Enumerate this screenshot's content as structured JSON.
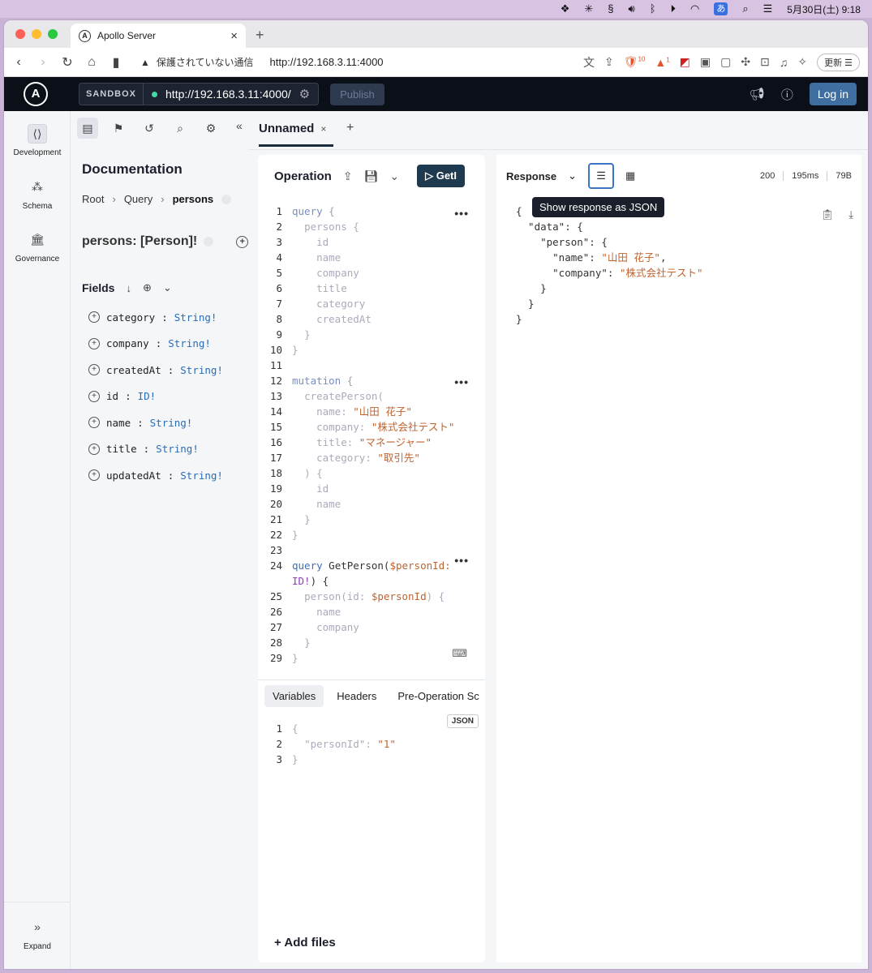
{
  "menubar": {
    "kana": "あ",
    "datetime": "5月30日(土)  9:18"
  },
  "browser": {
    "tab_title": "Apollo Server",
    "insecure_label": "保護されていない通信",
    "url": "http://192.168.3.11:4000",
    "brave_badge": "10",
    "alert_badge": "1",
    "update_label": "更新"
  },
  "header": {
    "sandbox_label": "SANDBOX",
    "endpoint": "http://192.168.3.11:4000/",
    "publish_label": "Publish",
    "login_label": "Log in"
  },
  "rail": {
    "items": [
      {
        "label": "Development"
      },
      {
        "label": "Schema"
      },
      {
        "label": "Governance"
      }
    ],
    "expand_label": "Expand"
  },
  "docs": {
    "title": "Documentation",
    "breadcrumb": [
      "Root",
      "Query",
      "persons"
    ],
    "type_title": "persons: [Person]!",
    "fields_label": "Fields",
    "fields": [
      {
        "name": "category",
        "type": "String!"
      },
      {
        "name": "company",
        "type": "String!"
      },
      {
        "name": "createdAt",
        "type": "String!"
      },
      {
        "name": "id",
        "type": "ID!"
      },
      {
        "name": "name",
        "type": "String!"
      },
      {
        "name": "title",
        "type": "String!"
      },
      {
        "name": "updatedAt",
        "type": "String!"
      }
    ]
  },
  "operation_tab": {
    "name": "Unnamed",
    "close": "×",
    "new": "+"
  },
  "operation": {
    "title": "Operation",
    "run_label": "▷ GetI",
    "line_numbers": [
      "1",
      "2",
      "3",
      "4",
      "5",
      "6",
      "7",
      "8",
      "9",
      "10",
      "11",
      "12",
      "13",
      "14",
      "15",
      "16",
      "17",
      "18",
      "19",
      "20",
      "21",
      "22",
      "23",
      "24",
      "",
      "25",
      "26",
      "27",
      "28",
      "29"
    ],
    "lines": {
      "l1_kw": "query",
      "l1_rest": " {",
      "l2": "persons {",
      "l3": "id",
      "l4": "name",
      "l5": "company",
      "l6": "title",
      "l7": "category",
      "l8": "createdAt",
      "l9": "}",
      "l10": "}",
      "l12_kw": "mutation",
      "l12_rest": " {",
      "l13": "createPerson(",
      "l14_k": "name: ",
      "l14_v": "\"山田 花子\"",
      "l15_k": "company: ",
      "l15_v": "\"株式会社テスト\"",
      "l16_k": "title: ",
      "l16_v": "\"マネージャー\"",
      "l17_k": "category: ",
      "l17_v": "\"取引先\"",
      "l18": ") {",
      "l19": "id",
      "l20": "name",
      "l21": "}",
      "l22": "}",
      "l24_kw": "query",
      "l24_name": " GetPerson(",
      "l24_var": "$personId:",
      "l24b_type": "ID!",
      "l24b_rest": ") {",
      "l25_a": "person(id: ",
      "l25_var": "$personId",
      "l25_b": ") {",
      "l26": "name",
      "l27": "company",
      "l28": "}",
      "l29": "}"
    }
  },
  "variables": {
    "tabs": [
      "Variables",
      "Headers",
      "Pre-Operation Sc"
    ],
    "json_badge": "JSON",
    "l1": "{",
    "l2_k": "\"personId\": ",
    "l2_v": "\"1\"",
    "l3": "}",
    "add_files": "+  Add files"
  },
  "response": {
    "label": "Response",
    "tooltip": "Show response as JSON",
    "status": "200",
    "time": "195ms",
    "size": "79B",
    "lines": {
      "r1": "{",
      "r2": "  \"data\": {",
      "r3": "    \"person\": {",
      "r4_k": "      \"name\": ",
      "r4_v": "\"山田 花子\"",
      "r4_c": ",",
      "r5_k": "      \"company\": ",
      "r5_v": "\"株式会社テスト\"",
      "r6": "    }",
      "r7": "  }",
      "r8": "}"
    }
  }
}
